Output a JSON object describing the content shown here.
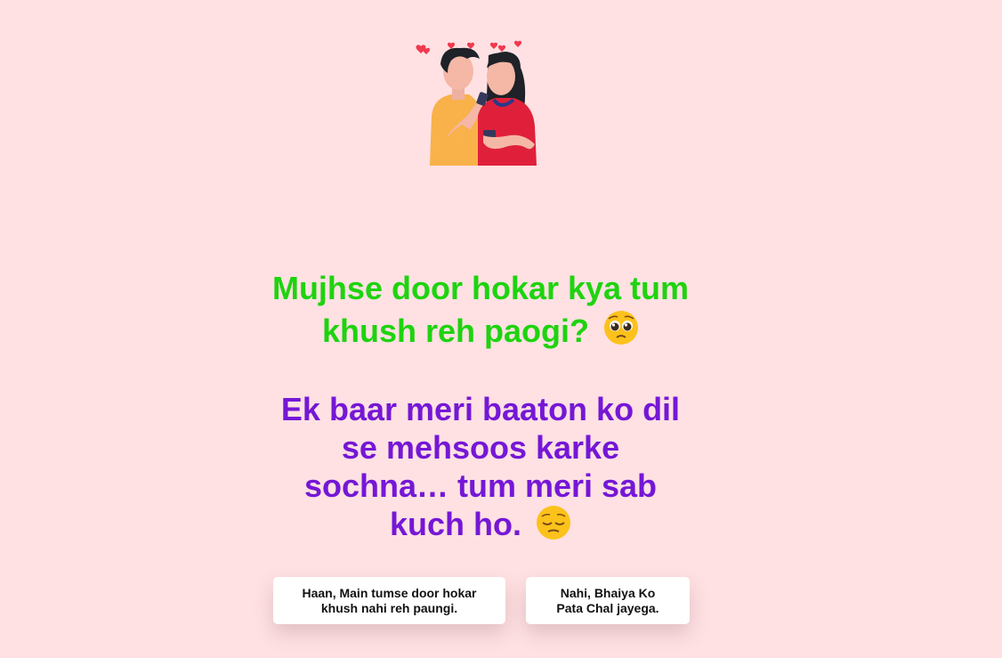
{
  "illustration": {
    "icon": "couple-illustration",
    "hearts_color": "#f1384e",
    "boy_shirt_color": "#f9b149",
    "girl_dress_color": "#e0203a"
  },
  "question": {
    "line1": "Mujhse door hokar kya tum khush reh paogi?",
    "line1_emoji": "pleading-face-emoji",
    "line2": "Ek baar meri baaton ko dil se mehsoos karke sochna… tum meri sab kuch ho.",
    "line2_emoji": "pensive-face-emoji",
    "line1_color": "#1ed30f",
    "line2_color": "#7517d6"
  },
  "buttons": {
    "yes_label": "Haan, Main tumse door hokar khush nahi reh paungi.",
    "no_label": "Nahi, Bhaiya Ko Pata Chal jayega."
  },
  "background_color": "#ffe1e3"
}
